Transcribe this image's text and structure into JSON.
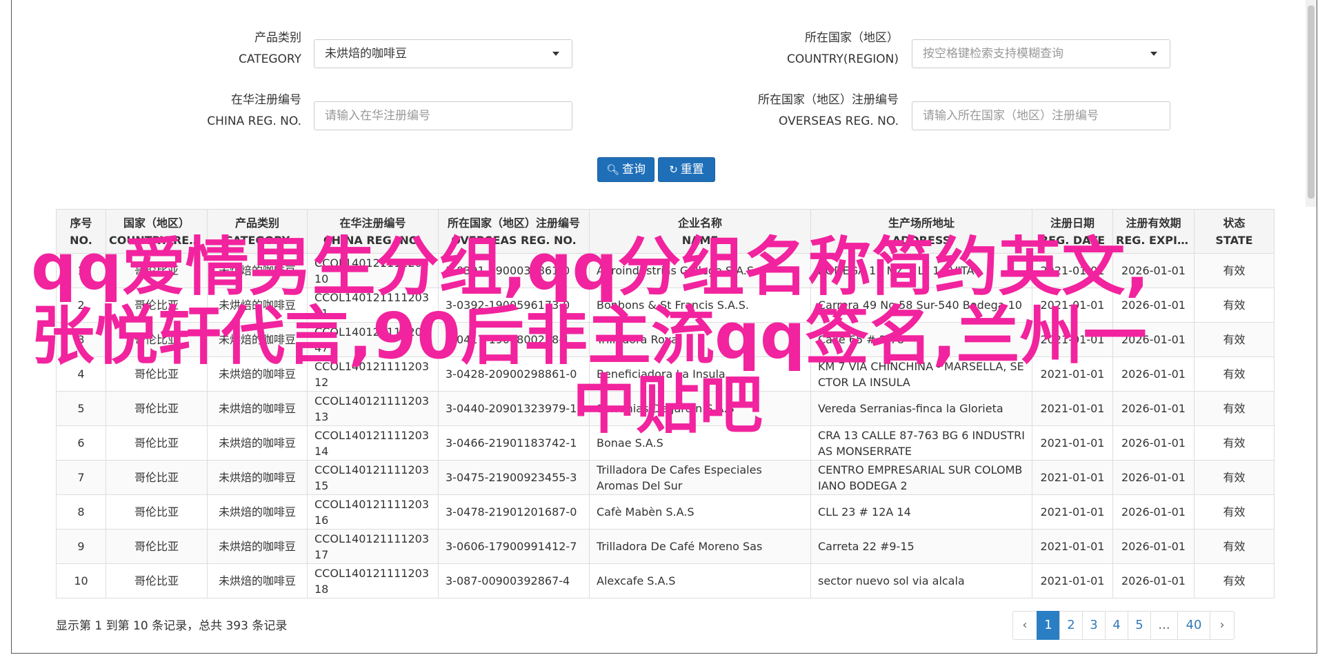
{
  "form": {
    "category_label_cn": "产品类别",
    "category_label_en": "CATEGORY",
    "category_value": "未烘焙的咖啡豆",
    "country_label_cn": "所在国家（地区）",
    "country_label_en": "COUNTRY(REGION)",
    "country_placeholder": "按空格键检索支持模糊查询",
    "china_reg_label_cn": "在华注册编号",
    "china_reg_label_en": "CHINA REG. NO.",
    "china_reg_placeholder": "请输入在华注册编号",
    "overseas_reg_label_cn": "所在国家（地区）注册编号",
    "overseas_reg_label_en": "OVERSEAS REG. NO.",
    "overseas_reg_placeholder": "请输入所在国家（地区）注册编号",
    "search_label": "查询",
    "reset_label": "重置"
  },
  "table": {
    "headers": [
      {
        "cn": "序号",
        "en": "NO."
      },
      {
        "cn": "国家（地区）",
        "en": "COUNTRY(REGIO..."
      },
      {
        "cn": "产品类别",
        "en": "CATEGORY"
      },
      {
        "cn": "在华注册编号",
        "en": "CHINA REG. NO."
      },
      {
        "cn": "所在国家（地区）注册编号",
        "en": "OVERSEAS REG. NO."
      },
      {
        "cn": "企业名称",
        "en": "NAME"
      },
      {
        "cn": "生产场所地址",
        "en": "ADDRESS"
      },
      {
        "cn": "注册日期",
        "en": "REG. DATE"
      },
      {
        "cn": "注册有效期",
        "en": "REG. EXPIRE ..."
      },
      {
        "cn": "状态",
        "en": "STATE"
      }
    ],
    "rows": [
      {
        "no": "1",
        "country": "哥伦比亚",
        "category": "未烘焙的咖啡豆",
        "china_reg": "CCOL140121111203 10",
        "overseas_reg": "3-0391-9900036861-0",
        "name": "Agroindustrias Gallego S.A.S",
        "address": "BODEGA 11 MZ 1 LT 1 AVITA",
        "reg_date": "2021-01-01",
        "expire": "2026-01-01",
        "state": "有效"
      },
      {
        "no": "2",
        "country": "哥伦比亚",
        "category": "未烘焙的咖啡豆",
        "china_reg": "CCOL140121111203 11",
        "overseas_reg": "3-0392-1900596173-0",
        "name": "Bonbons & St Francis S.A.S.",
        "address": "Carrera 49 No 58 Sur-540 Bodega 10",
        "reg_date": "2021-01-01",
        "expire": "2026-01-01",
        "state": "有效"
      },
      {
        "no": "3",
        "country": "哥伦比亚",
        "category": "未烘焙的咖啡豆",
        "china_reg": "CCOL140121111203 47",
        "overseas_reg": "3-0417-1900800218-1",
        "name": "Trilladora Royal",
        "address": "Calle 65 # 2-78",
        "reg_date": "2021-01-01",
        "expire": "2026-01-01",
        "state": "有效"
      },
      {
        "no": "4",
        "country": "哥伦比亚",
        "category": "未烘焙的咖啡豆",
        "china_reg": "CCOL140121111203 12",
        "overseas_reg": "3-0428-20900298861-0",
        "name": "Beneficiadora La Insula",
        "address": "KM 7 VIA CHINCHINA - MARSELLA, SECTOR LA INSULA",
        "reg_date": "2021-01-01",
        "expire": "2026-01-01",
        "state": "有效"
      },
      {
        "no": "5",
        "country": "哥伦比亚",
        "category": "未烘焙的咖啡豆",
        "china_reg": "CCOL140121111203 13",
        "overseas_reg": "3-0440-20901323979-1",
        "name": "Serranias De Jardin S.A.S",
        "address": "Vereda Serranias-finca la Glorieta",
        "reg_date": "2021-01-01",
        "expire": "2026-01-01",
        "state": "有效"
      },
      {
        "no": "6",
        "country": "哥伦比亚",
        "category": "未烘焙的咖啡豆",
        "china_reg": "CCOL140121111203 14",
        "overseas_reg": "3-0466-21901183742-1",
        "name": "Bonae S.A.S",
        "address": "CRA 13 CALLE 87-763 BG 6 INDUSTRIAS MONSERRATE",
        "reg_date": "2021-01-01",
        "expire": "2026-01-01",
        "state": "有效"
      },
      {
        "no": "7",
        "country": "哥伦比亚",
        "category": "未烘焙的咖啡豆",
        "china_reg": "CCOL140121111203 15",
        "overseas_reg": "3-0475-21900923455-3",
        "name": "Trilladora De Cafes Especiales Aromas Del Sur",
        "address": "CENTRO EMPRESARIAL SUR COLOMBIANO BODEGA 2",
        "reg_date": "2021-01-01",
        "expire": "2026-01-01",
        "state": "有效"
      },
      {
        "no": "8",
        "country": "哥伦比亚",
        "category": "未烘焙的咖啡豆",
        "china_reg": "CCOL140121111203 16",
        "overseas_reg": "3-0478-21901201687-0",
        "name": "Cafè Mabèn S.A.S",
        "address": "CLL 23 # 12A 14",
        "reg_date": "2021-01-01",
        "expire": "2026-01-01",
        "state": "有效"
      },
      {
        "no": "9",
        "country": "哥伦比亚",
        "category": "未烘焙的咖啡豆",
        "china_reg": "CCOL140121111203 17",
        "overseas_reg": "3-0606-17900991412-7",
        "name": "Trilladora De Café Moreno Sas",
        "address": "Carreta 22 #9-15",
        "reg_date": "2021-01-01",
        "expire": "2026-01-01",
        "state": "有效"
      },
      {
        "no": "10",
        "country": "哥伦比亚",
        "category": "未烘焙的咖啡豆",
        "china_reg": "CCOL140121111203 18",
        "overseas_reg": "3-087-00900392867-4",
        "name": "Alexcafe S.A.S",
        "address": "sector nuevo sol via alcala",
        "reg_date": "2021-01-01",
        "expire": "2026-01-01",
        "state": "有效"
      }
    ]
  },
  "footer": {
    "summary": "显示第 1 到第 10 条记录，总共 393 条记录",
    "pages": [
      "‹",
      "1",
      "2",
      "3",
      "4",
      "5",
      "...",
      "40",
      "›"
    ]
  },
  "overlay": {
    "line1": "qq爱情男生分组,qq分组名称简约英文,",
    "line2": "张悦轩代言,90后非主流qq签名,兰州一",
    "line3": "中贴吧"
  },
  "colors": {
    "primary": "#1f6fb8",
    "page_active": "#2a7ec3",
    "overlay_text": "#f2239e"
  }
}
